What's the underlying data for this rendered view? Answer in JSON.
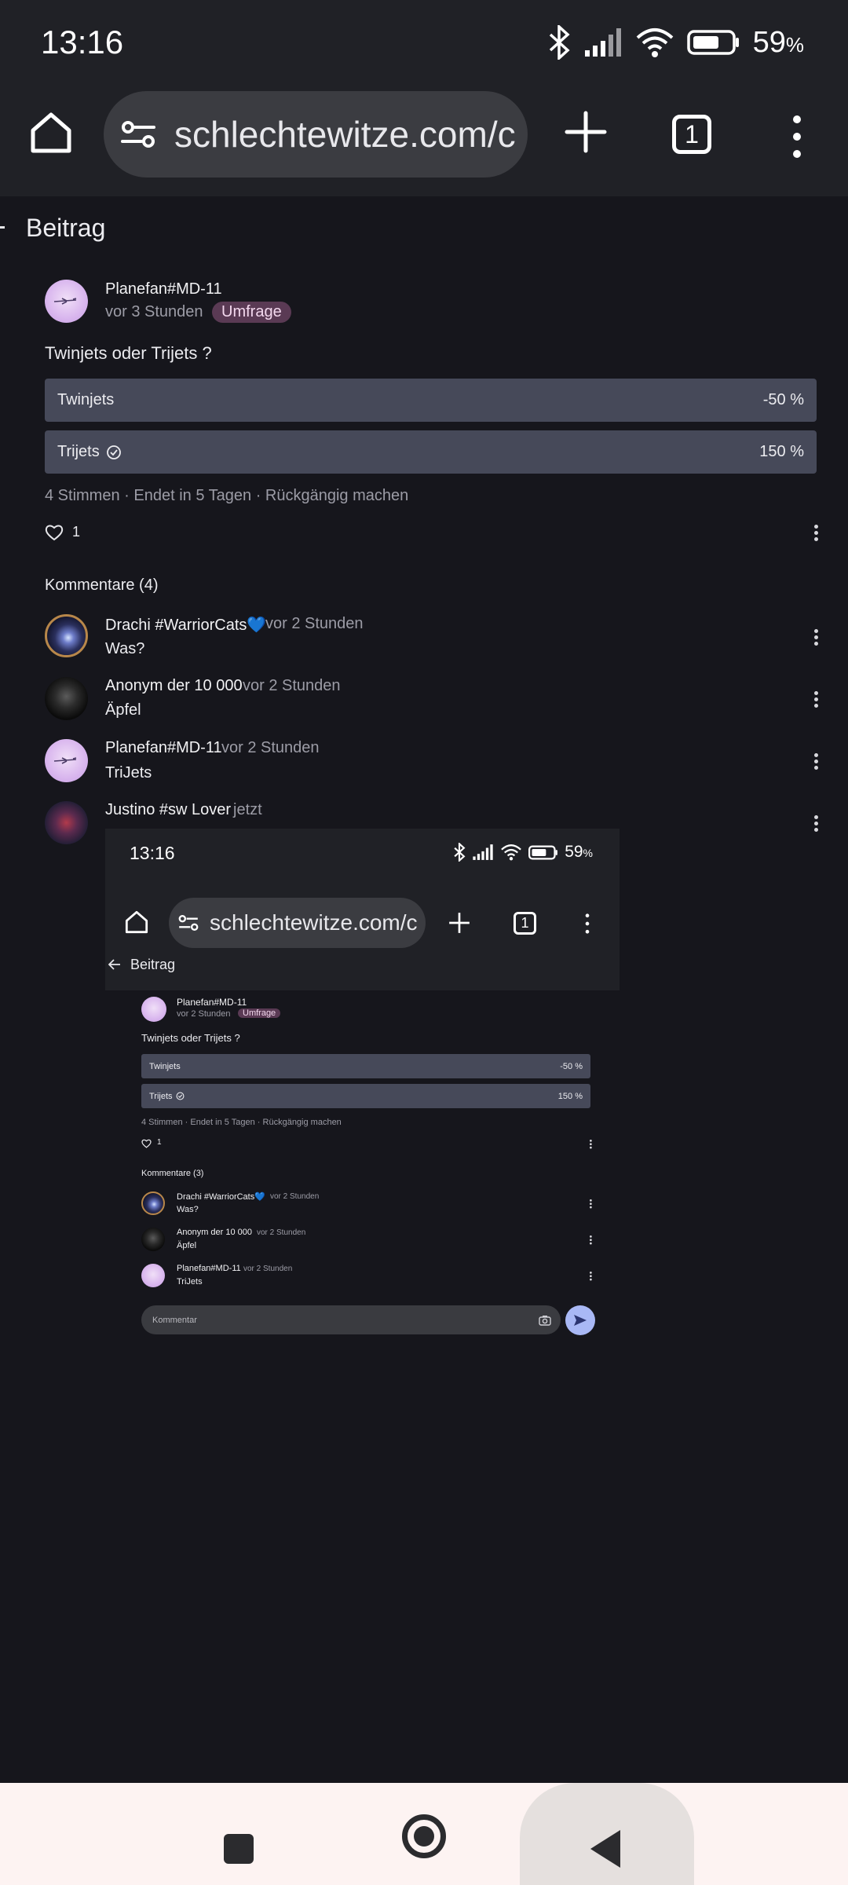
{
  "status": {
    "time": "13:16",
    "battery_pct": "59",
    "battery_unit": "%"
  },
  "toolbar": {
    "url": "schlechtewitze.com/c",
    "tab_count": "1"
  },
  "header": {
    "title": "Beitrag"
  },
  "post": {
    "author": "Planefan#MD-11",
    "time": "vor 3 Stunden",
    "badge": "Umfrage",
    "question": "Twinjets oder Trijets ?",
    "options": [
      {
        "label": "Twinjets",
        "pct": "-50 %"
      },
      {
        "label": "Trijets",
        "pct": "150 %"
      }
    ],
    "votes": "4 Stimmen",
    "ends": "Endet in 5 Tagen",
    "undo": "Rückgängig machen",
    "likes": "1"
  },
  "comments_header": "Kommentare (4)",
  "comments": [
    {
      "author": "Drachi #WarriorCats💙",
      "time": "vor 2 Stunden",
      "text": "Was?"
    },
    {
      "author": "Anonym der 10 000",
      "time": "vor 2 Stunden",
      "text": "Äpfel"
    },
    {
      "author": "Planefan#MD-11",
      "time": "vor 2 Stunden",
      "text": "TriJets"
    },
    {
      "author": "Justino #sw Lover",
      "time": "jetzt",
      "text": ""
    }
  ],
  "embed": {
    "time": "13:16",
    "battery_pct": "59",
    "url": "schlechtewitze.com/c",
    "tab_count": "1",
    "header": "Beitrag",
    "post_author": "Planefan#MD-11",
    "post_time": "vor 2 Stunden",
    "badge": "Umfrage",
    "question": "Twinjets oder Trijets ?",
    "options": [
      {
        "label": "Twinjets",
        "pct": "-50 %"
      },
      {
        "label": "Trijets",
        "pct": "150 %"
      }
    ],
    "votes": "4 Stimmen",
    "ends": "Endet in 5 Tagen",
    "undo": "Rückgängig machen",
    "likes": "1",
    "comments_header": "Kommentare (3)",
    "comments": [
      {
        "author": "Drachi #WarriorCats💙",
        "time": "vor 2 Stunden",
        "text": "Was?"
      },
      {
        "author": "Anonym der 10 000",
        "time": "vor 2 Stunden",
        "text": "Äpfel"
      },
      {
        "author": "Planefan#MD-11",
        "time": "vor 2 Stunden",
        "text": "TriJets"
      }
    ],
    "input_placeholder": "Kommentar"
  }
}
